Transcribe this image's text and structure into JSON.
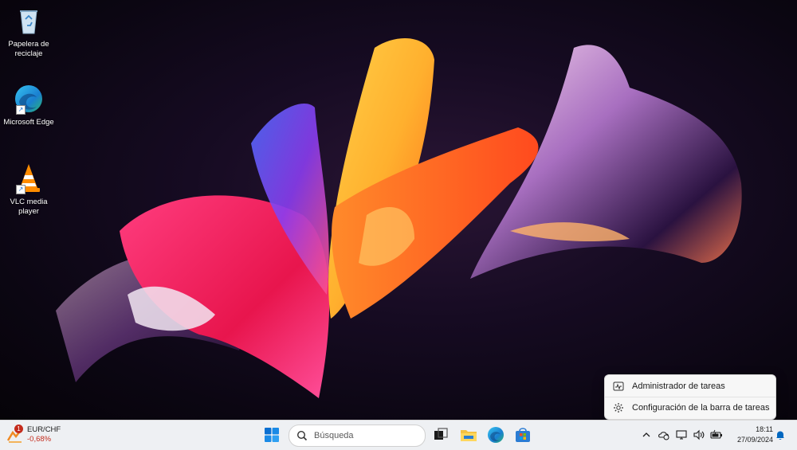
{
  "desktop": {
    "icons": [
      {
        "label": "Papelera de reciclaje",
        "icon": "recycle-bin-icon"
      },
      {
        "label": "Microsoft Edge",
        "icon": "edge-icon"
      },
      {
        "label": "VLC media player",
        "icon": "vlc-icon"
      }
    ]
  },
  "context_menu": {
    "items": [
      {
        "label": "Administrador de tareas",
        "icon": "task-manager-icon"
      },
      {
        "label": "Configuración de la barra de tareas",
        "icon": "gear-icon"
      }
    ]
  },
  "taskbar": {
    "widget": {
      "pair": "EUR/CHF",
      "change": "-0,68%",
      "badge": "1"
    },
    "search": {
      "placeholder": "Búsqueda"
    },
    "apps": [
      "task-view-icon",
      "file-explorer-icon",
      "edge-icon",
      "microsoft-store-icon"
    ],
    "tray": [
      "chevron-up-icon",
      "onedrive-sync-icon",
      "network-icon",
      "volume-icon",
      "battery-icon"
    ],
    "clock": {
      "time": "18:11",
      "date": "27/09/2024"
    },
    "notification_icon": "bell-icon"
  },
  "colors": {
    "taskbar_bg": "#eef0f3",
    "accent": "#0067c0",
    "negative": "#c42b1c"
  }
}
